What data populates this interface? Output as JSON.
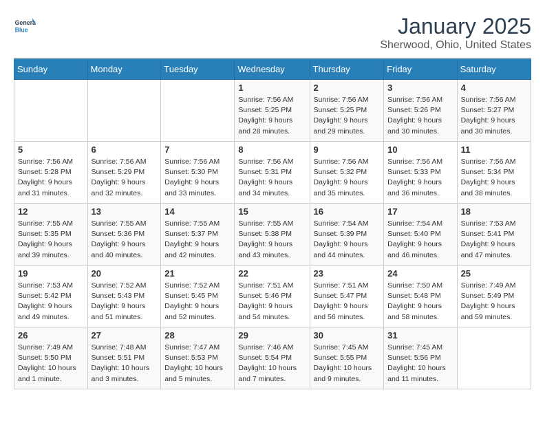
{
  "logo": {
    "line1": "General",
    "line2": "Blue"
  },
  "title": "January 2025",
  "subtitle": "Sherwood, Ohio, United States",
  "weekdays": [
    "Sunday",
    "Monday",
    "Tuesday",
    "Wednesday",
    "Thursday",
    "Friday",
    "Saturday"
  ],
  "weeks": [
    [
      {
        "day": null,
        "info": null
      },
      {
        "day": null,
        "info": null
      },
      {
        "day": null,
        "info": null
      },
      {
        "day": "1",
        "info": "Sunrise: 7:56 AM\nSunset: 5:25 PM\nDaylight: 9 hours\nand 28 minutes."
      },
      {
        "day": "2",
        "info": "Sunrise: 7:56 AM\nSunset: 5:25 PM\nDaylight: 9 hours\nand 29 minutes."
      },
      {
        "day": "3",
        "info": "Sunrise: 7:56 AM\nSunset: 5:26 PM\nDaylight: 9 hours\nand 30 minutes."
      },
      {
        "day": "4",
        "info": "Sunrise: 7:56 AM\nSunset: 5:27 PM\nDaylight: 9 hours\nand 30 minutes."
      }
    ],
    [
      {
        "day": "5",
        "info": "Sunrise: 7:56 AM\nSunset: 5:28 PM\nDaylight: 9 hours\nand 31 minutes."
      },
      {
        "day": "6",
        "info": "Sunrise: 7:56 AM\nSunset: 5:29 PM\nDaylight: 9 hours\nand 32 minutes."
      },
      {
        "day": "7",
        "info": "Sunrise: 7:56 AM\nSunset: 5:30 PM\nDaylight: 9 hours\nand 33 minutes."
      },
      {
        "day": "8",
        "info": "Sunrise: 7:56 AM\nSunset: 5:31 PM\nDaylight: 9 hours\nand 34 minutes."
      },
      {
        "day": "9",
        "info": "Sunrise: 7:56 AM\nSunset: 5:32 PM\nDaylight: 9 hours\nand 35 minutes."
      },
      {
        "day": "10",
        "info": "Sunrise: 7:56 AM\nSunset: 5:33 PM\nDaylight: 9 hours\nand 36 minutes."
      },
      {
        "day": "11",
        "info": "Sunrise: 7:56 AM\nSunset: 5:34 PM\nDaylight: 9 hours\nand 38 minutes."
      }
    ],
    [
      {
        "day": "12",
        "info": "Sunrise: 7:55 AM\nSunset: 5:35 PM\nDaylight: 9 hours\nand 39 minutes."
      },
      {
        "day": "13",
        "info": "Sunrise: 7:55 AM\nSunset: 5:36 PM\nDaylight: 9 hours\nand 40 minutes."
      },
      {
        "day": "14",
        "info": "Sunrise: 7:55 AM\nSunset: 5:37 PM\nDaylight: 9 hours\nand 42 minutes."
      },
      {
        "day": "15",
        "info": "Sunrise: 7:55 AM\nSunset: 5:38 PM\nDaylight: 9 hours\nand 43 minutes."
      },
      {
        "day": "16",
        "info": "Sunrise: 7:54 AM\nSunset: 5:39 PM\nDaylight: 9 hours\nand 44 minutes."
      },
      {
        "day": "17",
        "info": "Sunrise: 7:54 AM\nSunset: 5:40 PM\nDaylight: 9 hours\nand 46 minutes."
      },
      {
        "day": "18",
        "info": "Sunrise: 7:53 AM\nSunset: 5:41 PM\nDaylight: 9 hours\nand 47 minutes."
      }
    ],
    [
      {
        "day": "19",
        "info": "Sunrise: 7:53 AM\nSunset: 5:42 PM\nDaylight: 9 hours\nand 49 minutes."
      },
      {
        "day": "20",
        "info": "Sunrise: 7:52 AM\nSunset: 5:43 PM\nDaylight: 9 hours\nand 51 minutes."
      },
      {
        "day": "21",
        "info": "Sunrise: 7:52 AM\nSunset: 5:45 PM\nDaylight: 9 hours\nand 52 minutes."
      },
      {
        "day": "22",
        "info": "Sunrise: 7:51 AM\nSunset: 5:46 PM\nDaylight: 9 hours\nand 54 minutes."
      },
      {
        "day": "23",
        "info": "Sunrise: 7:51 AM\nSunset: 5:47 PM\nDaylight: 9 hours\nand 56 minutes."
      },
      {
        "day": "24",
        "info": "Sunrise: 7:50 AM\nSunset: 5:48 PM\nDaylight: 9 hours\nand 58 minutes."
      },
      {
        "day": "25",
        "info": "Sunrise: 7:49 AM\nSunset: 5:49 PM\nDaylight: 9 hours\nand 59 minutes."
      }
    ],
    [
      {
        "day": "26",
        "info": "Sunrise: 7:49 AM\nSunset: 5:50 PM\nDaylight: 10 hours\nand 1 minute."
      },
      {
        "day": "27",
        "info": "Sunrise: 7:48 AM\nSunset: 5:51 PM\nDaylight: 10 hours\nand 3 minutes."
      },
      {
        "day": "28",
        "info": "Sunrise: 7:47 AM\nSunset: 5:53 PM\nDaylight: 10 hours\nand 5 minutes."
      },
      {
        "day": "29",
        "info": "Sunrise: 7:46 AM\nSunset: 5:54 PM\nDaylight: 10 hours\nand 7 minutes."
      },
      {
        "day": "30",
        "info": "Sunrise: 7:45 AM\nSunset: 5:55 PM\nDaylight: 10 hours\nand 9 minutes."
      },
      {
        "day": "31",
        "info": "Sunrise: 7:45 AM\nSunset: 5:56 PM\nDaylight: 10 hours\nand 11 minutes."
      },
      {
        "day": null,
        "info": null
      }
    ]
  ]
}
